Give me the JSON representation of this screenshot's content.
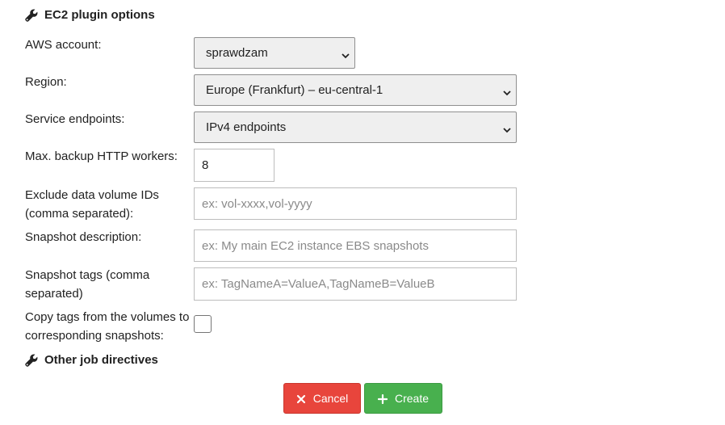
{
  "sections": {
    "ec2_title": "EC2 plugin options",
    "other_title": "Other job directives"
  },
  "fields": {
    "aws_account": {
      "label": "AWS account:",
      "value": "sprawdzam"
    },
    "region": {
      "label": "Region:",
      "value": "Europe (Frankfurt) – eu-central-1"
    },
    "service_endpoints": {
      "label": "Service endpoints:",
      "value": "IPv4 endpoints"
    },
    "max_workers": {
      "label": "Max. backup HTTP workers:",
      "value": "8"
    },
    "exclude_volumes": {
      "label": "Exclude data volume IDs (comma separated):",
      "placeholder": "ex: vol-xxxx,vol-yyyy"
    },
    "snapshot_description": {
      "label": "Snapshot description:",
      "placeholder": "ex: My main EC2 instance EBS snapshots"
    },
    "snapshot_tags": {
      "label": "Snapshot tags (comma separated)",
      "placeholder": "ex: TagNameA=ValueA,TagNameB=ValueB"
    },
    "copy_tags": {
      "label": "Copy tags from the volumes to corresponding snapshots:",
      "checked": false
    }
  },
  "buttons": {
    "cancel": "Cancel",
    "create": "Create"
  },
  "icons": {
    "section": "wrench-icon",
    "select_arrow": "chevron-down-icon",
    "cancel": "close-icon",
    "create": "plus-icon"
  },
  "colors": {
    "cancel_bg": "#e8453c",
    "create_bg": "#48b04e"
  }
}
